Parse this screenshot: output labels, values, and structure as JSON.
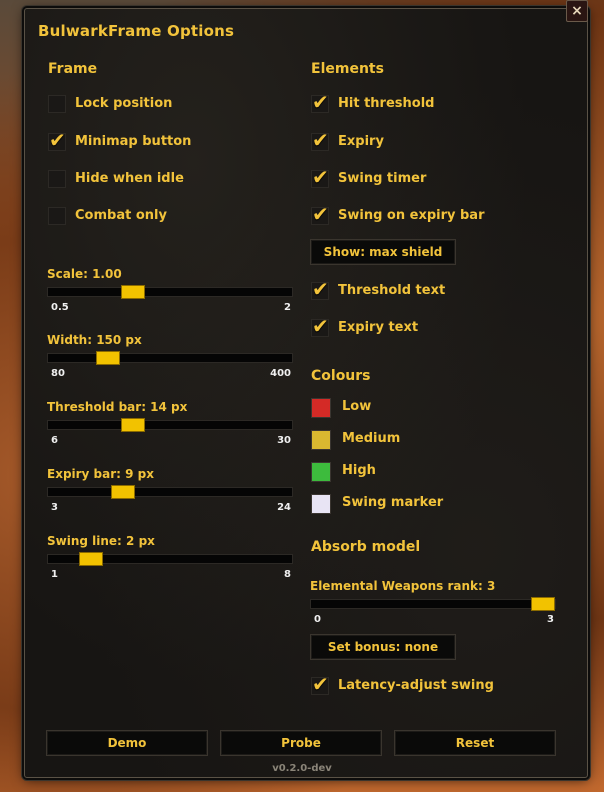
{
  "window": {
    "title": "BulwarkFrame Options",
    "close_label": "×",
    "version": "v0.2.0-dev"
  },
  "frame_section": {
    "header": "Frame",
    "options": [
      {
        "label": "Lock position",
        "checked": false
      },
      {
        "label": "Minimap button",
        "checked": true
      },
      {
        "label": "Hide when idle",
        "checked": false
      },
      {
        "label": "Combat only",
        "checked": false
      }
    ]
  },
  "sliders": [
    {
      "label": "Scale: 1.00",
      "min": "0.5",
      "max": "2",
      "value": 1.0,
      "min_value": 0.5,
      "max_value": 2
    },
    {
      "label": "Width: 150 px",
      "min": "80",
      "max": "400",
      "value": 150,
      "min_value": 80,
      "max_value": 400
    },
    {
      "label": "Threshold bar: 14 px",
      "min": "6",
      "max": "30",
      "value": 14,
      "min_value": 6,
      "max_value": 30
    },
    {
      "label": "Expiry bar: 9 px",
      "min": "3",
      "max": "24",
      "value": 9,
      "min_value": 3,
      "max_value": 24
    },
    {
      "label": "Swing line: 2 px",
      "min": "1",
      "max": "8",
      "value": 2,
      "min_value": 1,
      "max_value": 8
    }
  ],
  "elements_section": {
    "header": "Elements",
    "options": [
      {
        "label": "Hit threshold",
        "checked": true
      },
      {
        "label": "Expiry",
        "checked": true
      },
      {
        "label": "Swing timer",
        "checked": true
      },
      {
        "label": "Swing on expiry bar",
        "checked": true
      }
    ],
    "show_button": "Show: max shield",
    "options2": [
      {
        "label": "Threshold text",
        "checked": true
      },
      {
        "label": "Expiry text",
        "checked": true
      }
    ]
  },
  "colours": {
    "header": "Colours",
    "items": [
      {
        "label": "Low",
        "color": "#d42a26"
      },
      {
        "label": "Medium",
        "color": "#d9b830"
      },
      {
        "label": "High",
        "color": "#3dbb3d"
      },
      {
        "label": "Swing marker",
        "color": "#e8e4f4"
      }
    ]
  },
  "absorb": {
    "header": "Absorb model",
    "rank_slider": {
      "label": "Elemental Weapons rank: 3",
      "min": "0",
      "max": "3",
      "value": 3,
      "min_value": 0,
      "max_value": 3
    },
    "set_bonus_button": "Set bonus: none",
    "latency": {
      "label": "Latency-adjust swing",
      "checked": true
    }
  },
  "footer_buttons": {
    "demo": "Demo",
    "probe": "Probe",
    "reset": "Reset"
  }
}
